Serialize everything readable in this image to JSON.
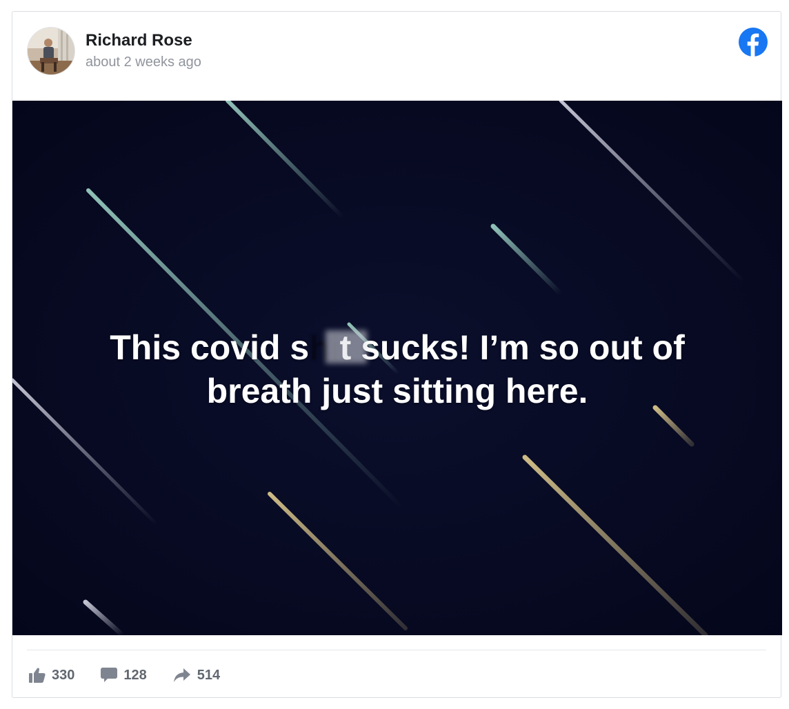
{
  "post": {
    "author": "Richard Rose",
    "timestamp": "about 2 weeks ago",
    "text_line1_a": "This covid s",
    "text_line1_censored": "hi",
    "text_line1_b": "t sucks! I’m so out of",
    "text_line2": "breath just sitting here.",
    "platform_icon": "facebook-logo"
  },
  "stats": {
    "likes": "330",
    "comments": "128",
    "shares": "514"
  },
  "colors": {
    "facebook_blue": "#1877f2",
    "image_background": "#070a1f",
    "stat_text": "#616770"
  }
}
